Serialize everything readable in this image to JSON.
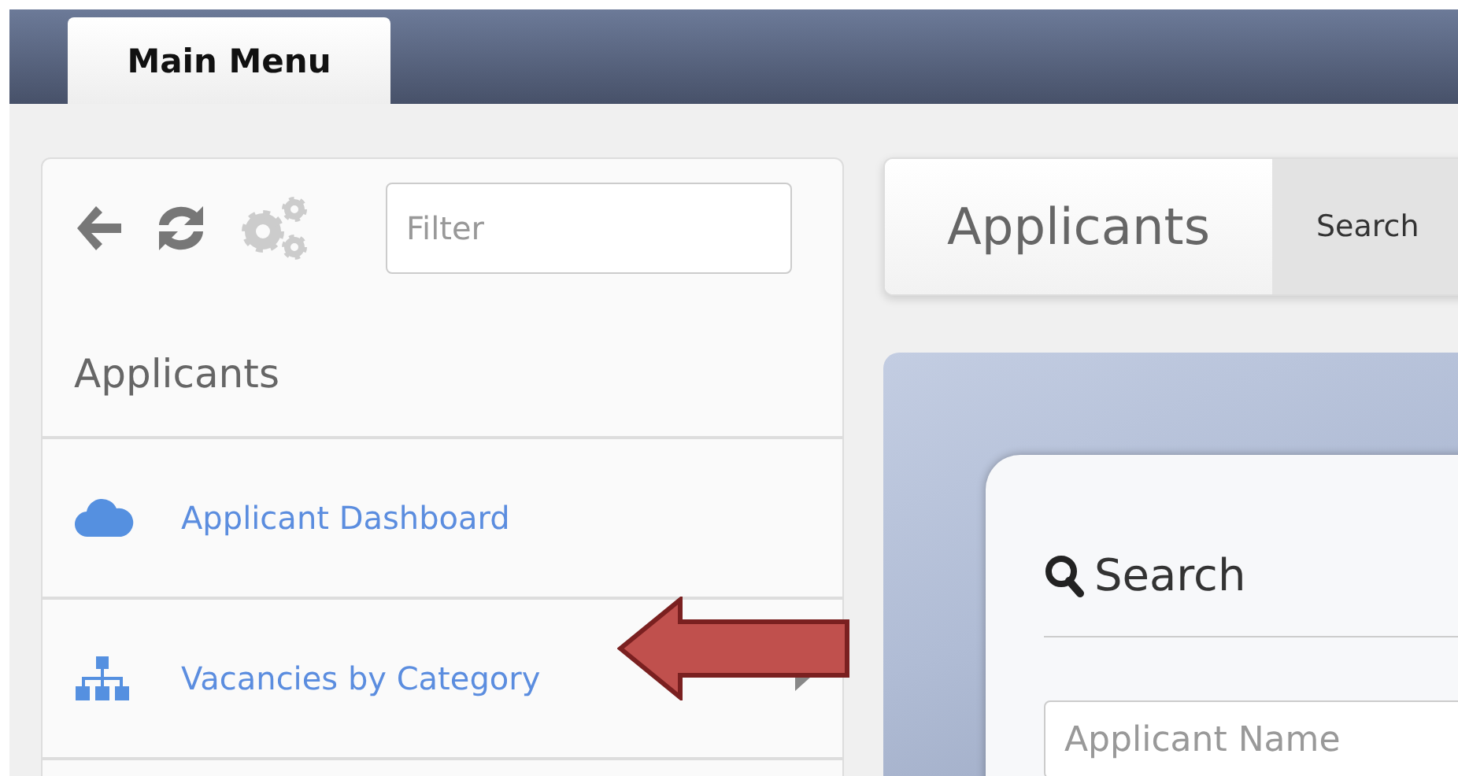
{
  "tabs": [
    {
      "label": "Main Menu",
      "selected": true
    }
  ],
  "sidebar": {
    "filter": {
      "placeholder": "Filter"
    },
    "section": "Applicants",
    "items": [
      {
        "label": "Applicant Dashboard",
        "kind": "cloud",
        "chevron": false
      },
      {
        "label": "Vacancies by Category",
        "kind": "sitemap",
        "chevron": true
      }
    ]
  },
  "header": {
    "title": "Applicants",
    "buttons": [
      "Search"
    ]
  },
  "search_panel": {
    "heading": "Search",
    "fields": [
      {
        "placeholder": "Applicant Name"
      }
    ]
  }
}
